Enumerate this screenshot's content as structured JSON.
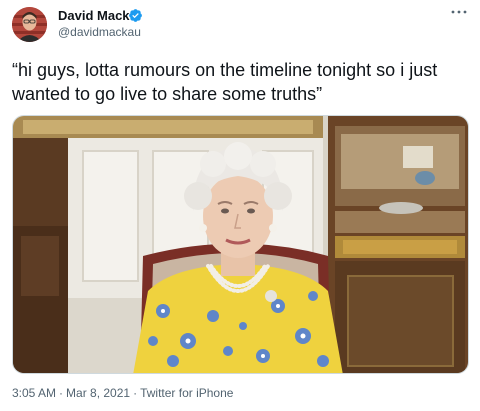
{
  "author": {
    "display_name": "David Mack",
    "handle": "@davidmackau",
    "verified": true,
    "avatar_icon": "user-avatar"
  },
  "tweet": {
    "text": "“hi guys, lotta rumours on the timeline tonight so i just wanted to go live to share some truths”"
  },
  "meta": {
    "time": "3:05 AM",
    "separator": "·",
    "date": "Mar 8, 2021",
    "source": "Twitter for iPhone"
  },
  "icons": {
    "more": "more-options-icon",
    "verified": "verified-badge-icon"
  },
  "colors": {
    "verified_blue": "#1d9bf0",
    "secondary_text": "#536471",
    "primary_text": "#0f1419"
  }
}
